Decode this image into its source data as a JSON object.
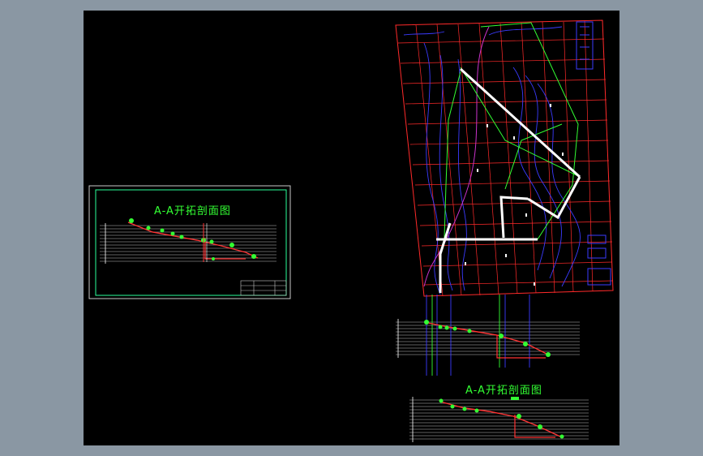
{
  "drawing": {
    "section_title_left": "A-A开拓剖面图",
    "section_title_bottom": "A-A开拓剖面图"
  },
  "colors": {
    "app_background": "#8a97a3",
    "drawing_background": "#000000",
    "grid_red": "#ff2a2a",
    "contour_blue": "#3b3bff",
    "road_green": "#33ff33",
    "frame_cyan": "#2aff9a",
    "magenta_text": "#cc33cc",
    "tunnel_white": "#ffffff"
  },
  "icons": [
    "title-block-icon",
    "legend-box-icon"
  ]
}
